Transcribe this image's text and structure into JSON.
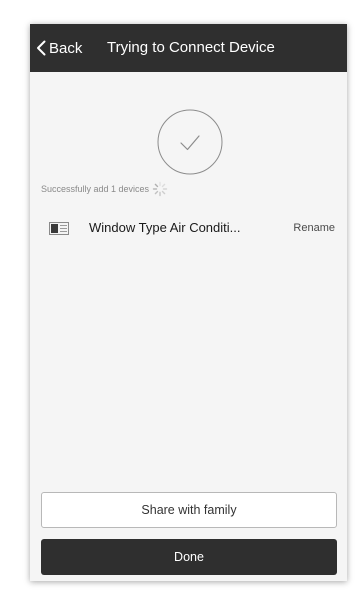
{
  "nav": {
    "back_label": "Back",
    "title": "Trying to Connect Device"
  },
  "status": {
    "message": "Successfully add 1 devices",
    "icon": "check-circle-icon",
    "loading_icon": "spinner-icon"
  },
  "devices": [
    {
      "name": "Window Type Air Conditi...",
      "icon": "air-conditioner-icon",
      "action_label": "Rename"
    }
  ],
  "actions": {
    "share_label": "Share with family",
    "done_label": "Done"
  },
  "colors": {
    "nav_background": "#2f2f2f",
    "screen_background": "#f5f5f5",
    "primary_button": "#2f2f2f",
    "secondary_button_border": "#b8b8b8"
  }
}
